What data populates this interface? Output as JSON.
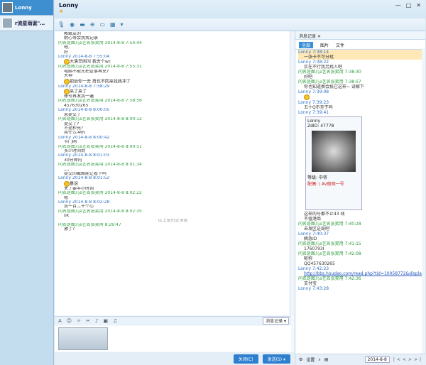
{
  "sidebar": {
    "contacts": [
      {
        "name": "Lonny"
      },
      {
        "name": "r流星雨诞\"…"
      }
    ]
  },
  "window": {
    "title": "Lonny",
    "star": "★",
    "buttons": [
      "—",
      "□",
      "✕"
    ]
  },
  "chat": {
    "messages": [
      {
        "k": "c",
        "t": "教赋友的"
      },
      {
        "k": "c",
        "t": "耐心等会我找记录"
      },
      {
        "k": "o",
        "t": "问名是图儿e艺名张笑用 2014-8-8 7:54:44"
      },
      {
        "k": "c",
        "t": "嗯,"
      },
      {
        "k": "c",
        "t": "好"
      },
      {
        "k": "l",
        "t": "Lonny 2014-8-8 7:55:04"
      },
      {
        "k": "c",
        "t": "大清早困叫 我去个wc",
        "emo": true
      },
      {
        "k": "o",
        "t": "问名是图儿e艺名张笑用 2014-8-8 7:55:31"
      },
      {
        "k": "c",
        "t": "电脑不能光把证事再充?"
      },
      {
        "k": "c",
        "t": "大神"
      },
      {
        "k": "c",
        "t": "把后你一去 再也不回来找我冲了",
        "emo": true
      },
      {
        "k": "l",
        "t": "Lonny 2014-8-8 7:58:29"
      },
      {
        "k": "c",
        "t": "来了来了",
        "emo": true
      },
      {
        "k": "c",
        "t": "帐号再发我一遍"
      },
      {
        "k": "o",
        "t": "问名是图儿e艺名张笑用 2014-8-8 7:58:56"
      },
      {
        "k": "c",
        "t": "457630265"
      },
      {
        "k": "l",
        "t": "Lonny 2014-8-8 8:00:05"
      },
      {
        "k": "c",
        "t": "息提交了"
      },
      {
        "k": "o",
        "t": "问名是图儿e艺名张笑用 2014-8-8 8:00:12"
      },
      {
        "k": "c",
        "t": "提交了?"
      },
      {
        "k": "c",
        "t": "不是秒充?"
      },
      {
        "k": "c",
        "t": "用什么冲的"
      },
      {
        "k": "l",
        "t": "Lonny 2014-8-8 8:00:42"
      },
      {
        "k": "c",
        "t": "卡门网"
      },
      {
        "k": "o",
        "t": "问名是图儿e艺名张笑用 2014-8-8 8:00:51"
      },
      {
        "k": "c",
        "t": "多少时间到"
      },
      {
        "k": "l",
        "t": "Lonny 2014-8-8 8:01:03"
      },
      {
        "k": "c",
        "t": "30分钟内"
      },
      {
        "k": "o",
        "t": "问名是图儿e艺名张笑用 2014-8-8 8:01:34"
      },
      {
        "k": "c",
        "t": ",,,,"
      },
      {
        "k": "c",
        "t": "提交的截图能让看下吗"
      },
      {
        "k": "l",
        "t": "Lonny 2014-8-8 8:01:52"
      },
      {
        "k": "c",
        "t": "暴说",
        "emo": true
      },
      {
        "k": "c",
        "t": "关了要半小时到"
      },
      {
        "k": "o",
        "t": "问名是图儿e艺名张笑用 2014-8-8 8:02:22"
      },
      {
        "k": "c",
        "t": "嗯"
      },
      {
        "k": "l",
        "t": "Lonny 2014-8-8 8:02:28"
      },
      {
        "k": "c",
        "t": "双一百二十个心"
      },
      {
        "k": "o",
        "t": "问名是图儿e艺名张笑用 2014-8-8 8:02:35"
      },
      {
        "k": "c",
        "t": "ok"
      },
      {
        "k": "sep",
        "t": "以上是历史消息"
      },
      {
        "k": "o",
        "t": "问名是图儿e艺名张笑用 8:29:47"
      },
      {
        "k": "c",
        "t": "激了?"
      }
    ]
  },
  "toolbar": {
    "history_button": "消息记录 ▾",
    "close_button": "关闭(C)",
    "send_button": "发送(S) ▾"
  },
  "history": {
    "title": "消息记录",
    "close": "✕",
    "tabs": [
      "全部",
      "图片",
      "文件"
    ],
    "messages": [
      {
        "k": "l",
        "t": "Lonny      7:38:14",
        "sel": true
      },
      {
        "k": "c",
        "t": "一张卡不可分批",
        "sel": true
      },
      {
        "k": "l",
        "t": "Lonny      7:38:22"
      },
      {
        "k": "c",
        "t": "实在不行我另找人吧"
      },
      {
        "k": "o",
        "t": "问名是图儿e艺名张笑用 7:38:30"
      },
      {
        "k": "c",
        "t": "好吧"
      },
      {
        "k": "o",
        "t": "问名是图儿e艺名张笑用 7:38:57"
      },
      {
        "k": "c",
        "t": "你也知道换会抵它这样~ 讲解下"
      },
      {
        "k": "l",
        "t": "Lonny      7:39:08"
      },
      {
        "k": "emo",
        "t": ""
      },
      {
        "k": "l",
        "t": "Lonny      7:39:23"
      },
      {
        "k": "c",
        "t": "五十Q币至于吗"
      },
      {
        "k": "l",
        "t": "Lonny      7:39:41"
      }
    ],
    "card": {
      "name": "Lonny",
      "id": "ZdID: 47778",
      "level": "等级: 中将",
      "badge": "配偶: \\ AV般网一号"
    },
    "messages2": [
      {
        "k": "c",
        "t": "这样的号都不止43 线"
      },
      {
        "k": "c",
        "t": "不值港商"
      },
      {
        "k": "o",
        "t": "问名是图儿e艺名张笑用 7:40:28"
      },
      {
        "k": "c",
        "t": "去发区证局吧"
      },
      {
        "k": "l",
        "t": "Lonny      7:40:37"
      },
      {
        "k": "c",
        "t": "腾急ID"
      },
      {
        "k": "o",
        "t": "问名是图儿e艺名张笑用 7:41:15"
      },
      {
        "k": "c",
        "t": "1760793I"
      },
      {
        "k": "o",
        "t": "问名是图儿e艺名张笑用 7:42:08"
      },
      {
        "k": "c",
        "t": "昵称"
      },
      {
        "k": "c",
        "t": "QQ457630265"
      },
      {
        "k": "l",
        "t": "Lonny      7:42:23"
      },
      {
        "k": "link",
        "t": "http://bbs.houdao.com/read.php?tid=10058772&displayMode=1"
      },
      {
        "k": "o",
        "t": "问名是图儿e艺名张笑用 7:42:36"
      },
      {
        "k": "c",
        "t": "支付宝"
      },
      {
        "k": "l",
        "t": "Lonny      7:43:28"
      }
    ],
    "footer": {
      "settings": "设置",
      "date": "2014-8-8"
    }
  }
}
